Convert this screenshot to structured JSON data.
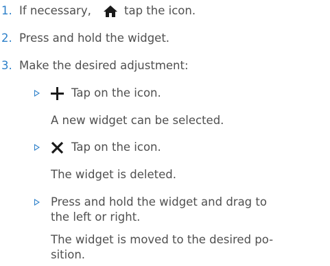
{
  "steps": [
    {
      "number": "1.",
      "before_icon": "If necessary,",
      "icon": "home-icon",
      "after_icon": "tap the icon."
    },
    {
      "number": "2.",
      "text": "Press and hold the widget."
    },
    {
      "number": "3.",
      "text": "Make the desired adjustment:"
    }
  ],
  "substeps": [
    {
      "icon": "plus-icon",
      "text": "Tap on the icon.",
      "result": "A new widget can be selected."
    },
    {
      "icon": "close-icon",
      "text": "Tap on the icon.",
      "result": "The widget is deleted."
    },
    {
      "text_line1": "Press and hold the widget and drag to",
      "text_line2": "the left or right.",
      "result_line1": "The widget is moved to the desired po-",
      "result_line2": "sition."
    }
  ],
  "colors": {
    "accent": "#2b7fc9",
    "text": "#4f4f4f",
    "icon": "#1a1a1a"
  }
}
